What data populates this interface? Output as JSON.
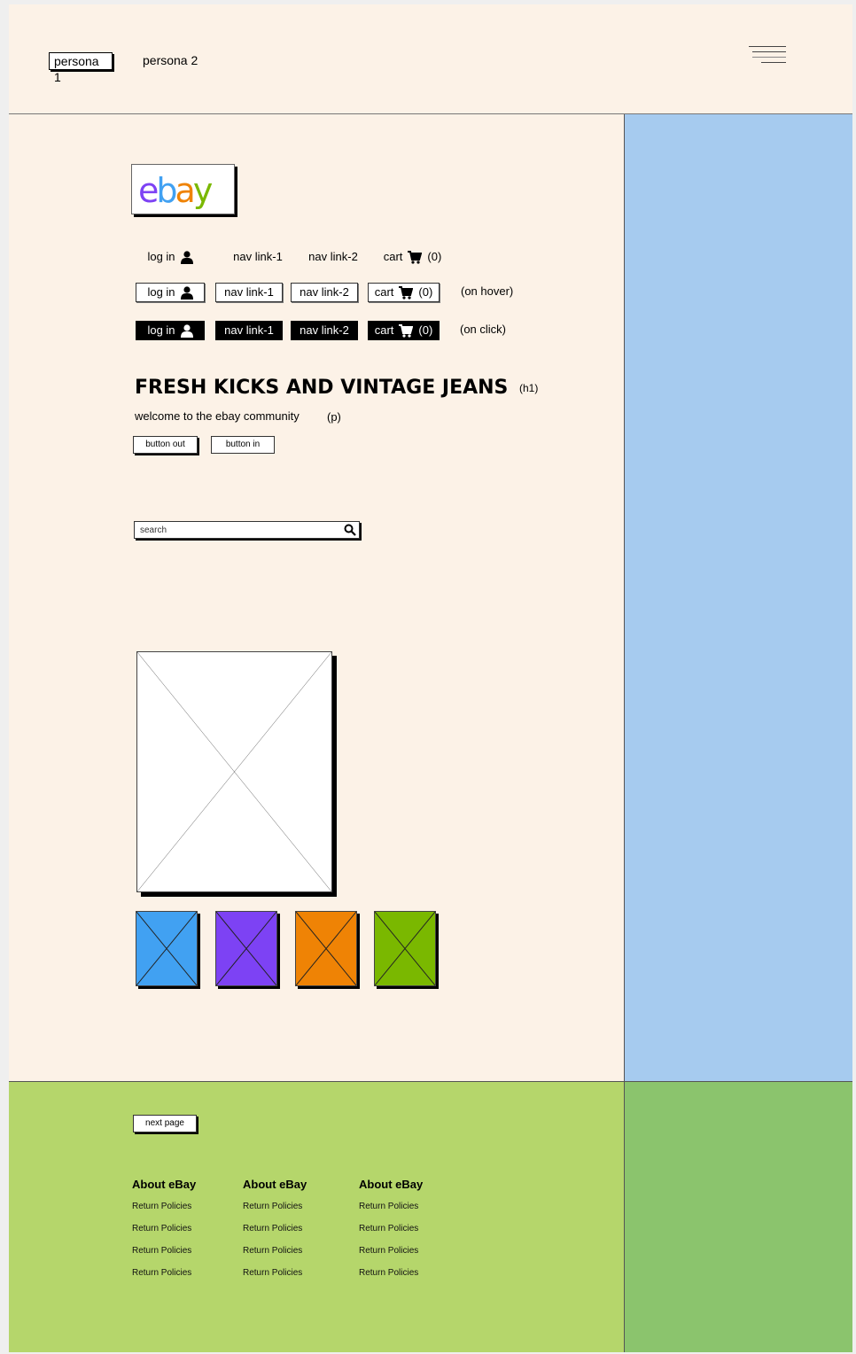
{
  "colors": {
    "page_bg": "#fcf2e7",
    "sidebar_bg": "#a6cbef",
    "footer_bg": "#b5d66b",
    "footer_side_bg": "#8bc46d",
    "thumb_blue": "#41a1f2",
    "thumb_purple": "#7d42f4",
    "thumb_orange": "#ef8305",
    "thumb_green": "#7ab800"
  },
  "header": {
    "persona_1": "persona 1",
    "persona_2": "persona 2",
    "menu_icon": "hamburger-icon"
  },
  "logo": {
    "text": "ebay",
    "letters": [
      "e",
      "b",
      "a",
      "y"
    ],
    "letter_colors": [
      "#7d42f4",
      "#41a1f2",
      "#ef8305",
      "#7ab800"
    ]
  },
  "nav_rows": [
    {
      "state": "",
      "login": "log in",
      "link1": "nav link-1",
      "link2": "nav link-2",
      "cart": "cart",
      "cart_count": "(0)"
    },
    {
      "state": "(on hover)",
      "login": "log in",
      "link1": "nav link-1",
      "link2": "nav link-2",
      "cart": "cart",
      "cart_count": "(0)"
    },
    {
      "state": "(on click)",
      "login": "log in",
      "link1": "nav link-1",
      "link2": "nav link-2",
      "cart": "cart",
      "cart_count": "(0)"
    }
  ],
  "hero": {
    "title": "FRESH KICKS AND VINTAGE JEANS",
    "title_tag": "(h1)",
    "paragraph": "welcome to the ebay community",
    "paragraph_tag": "(p)",
    "button_out": "button out",
    "button_in": "button in"
  },
  "search": {
    "placeholder": "search",
    "icon": "search-icon"
  },
  "gallery": {
    "thumbnails": [
      "blue",
      "purple",
      "orange",
      "green"
    ]
  },
  "footer": {
    "next_page": "next page",
    "columns": [
      {
        "heading": "About eBay",
        "links": [
          "Return Policies",
          "Return Policies",
          "Return Policies",
          "Return Policies"
        ]
      },
      {
        "heading": "About eBay",
        "links": [
          "Return Policies",
          "Return Policies",
          "Return Policies",
          "Return Policies"
        ]
      },
      {
        "heading": "About eBay",
        "links": [
          "Return Policies",
          "Return Policies",
          "Return Policies",
          "Return Policies"
        ]
      }
    ]
  }
}
